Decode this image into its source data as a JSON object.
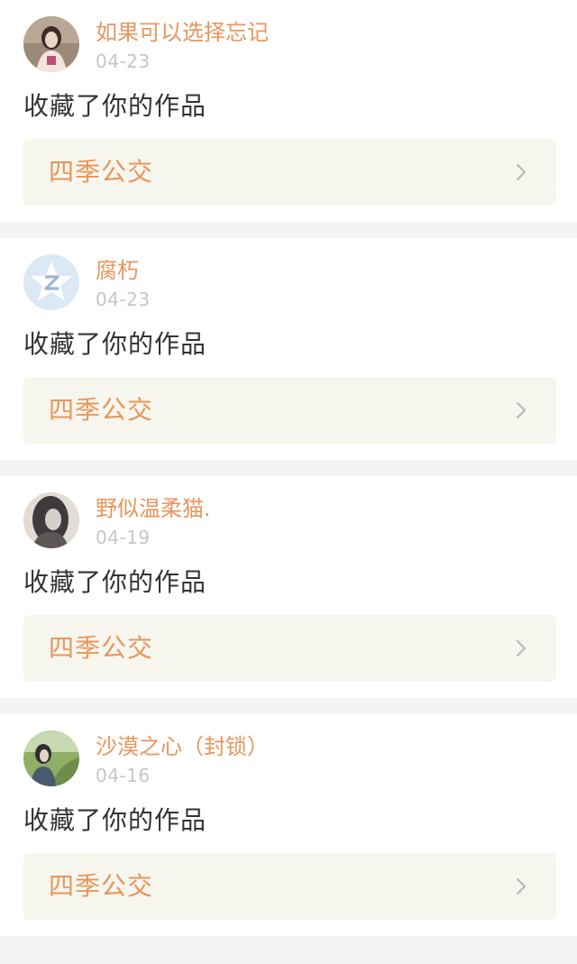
{
  "notifications": [
    {
      "username": "如果可以选择忘记",
      "date": "04-23",
      "action": "收藏了你的作品",
      "work_title": "四季公交",
      "avatar_icon": "avatar-photo-girl-pink",
      "avatar_colors": [
        "#8c7866",
        "#e7d7c9",
        "#c24f7a"
      ]
    },
    {
      "username": "腐朽",
      "date": "04-23",
      "action": "收藏了你的作品",
      "work_title": "四季公交",
      "avatar_icon": "qzone-default-icon",
      "avatar_colors": [
        "#dce8f4",
        "#ffffff",
        "#9db8d6"
      ]
    },
    {
      "username": "野似温柔猫.",
      "date": "04-19",
      "action": "收藏了你的作品",
      "work_title": "四季公交",
      "avatar_icon": "avatar-photo-dark-hair",
      "avatar_colors": [
        "#3e3a3d",
        "#d8cfc9",
        "#5e5557"
      ]
    },
    {
      "username": "沙漠之心（封锁）",
      "date": "04-16",
      "action": "收藏了你的作品",
      "work_title": "四季公交",
      "avatar_icon": "avatar-photo-green-field",
      "avatar_colors": [
        "#7a9a55",
        "#c8d8b0",
        "#3b4a3a"
      ]
    }
  ],
  "theme": {
    "accent": "#e8955b",
    "date_color": "#c6c6c6",
    "link_bg": "#f6f6ee",
    "separator": "#f4f4f4"
  }
}
